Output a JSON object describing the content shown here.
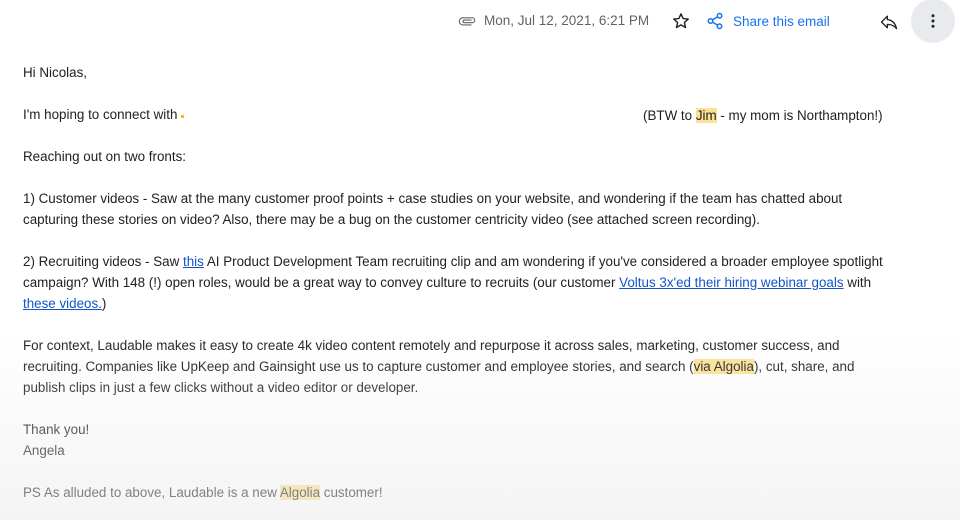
{
  "header": {
    "date": "Mon, Jul 12, 2021, 6:21 PM",
    "share_label": "Share this email",
    "icons": {
      "attachment": "paperclip-icon",
      "star": "star-icon",
      "share": "share-icon",
      "reply": "reply-icon",
      "more": "more-vert-icon"
    }
  },
  "email": {
    "greeting": "Hi Nicolas,",
    "intro": "I'm hoping to connect with",
    "btw_prefix": "(BTW to ",
    "btw_name": "Jim",
    "btw_suffix": " - my mom is Northampton!)",
    "fronts": "Reaching out on two fronts:",
    "item1_line1": "1) Customer videos - Saw at the many customer proof points + case studies on your website, and wondering if the team has chatted about",
    "item1_line2": "capturing these stories on video? Also, there may be a bug on the customer centricity video (see attached screen recording).",
    "item2_prefix": "2) Recruiting videos - Saw ",
    "item2_link": "this",
    "item2_rest": " AI Product Development Team recruiting clip and am wondering if you've considered a broader employee spotlight",
    "item2_line2_prefix": "campaign? With 148 (!) open roles, would be a great way to convey culture to recruits (our customer ",
    "item2_link2": "Voltus 3x'ed their hiring webinar goals",
    "item2_line2_suffix": " with",
    "item2_link3": "these videos.",
    "item2_close": ")",
    "context_line1": "For context, Laudable makes it easy to create 4k video content remotely and repurpose it across sales, marketing, customer success, and",
    "context_line2_prefix": "recruiting. Companies like UpKeep and Gainsight use us to capture customer and employee stories, and search (",
    "context_via": "via ",
    "context_algolia": "Algolia",
    "context_line2_suffix": "), cut, share, and",
    "context_line3": "publish clips in just a few clicks without a video editor or developer.",
    "thanks": "Thank you!",
    "signature": "Angela",
    "ps_prefix": "PS As alluded to above, Laudable is a new ",
    "ps_algolia": "Algolia",
    "ps_suffix": " customer!"
  },
  "colors": {
    "highlight": "#fde293",
    "link": "#1155cc",
    "share": "#1a73e8"
  }
}
